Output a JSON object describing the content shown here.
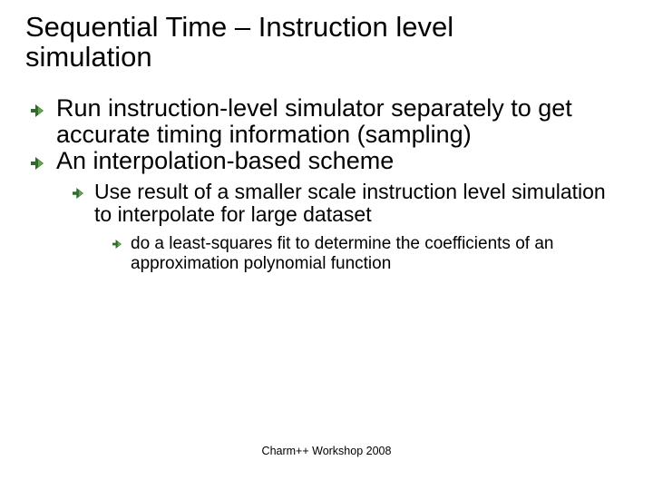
{
  "title": {
    "line1": "Sequential Time – Instruction level",
    "line2": "simulation"
  },
  "bullets": {
    "l1a": "Run instruction-level simulator separately to get accurate timing information (sampling)",
    "l1b": "An interpolation-based scheme",
    "l2a": "Use result of a smaller scale instruction level simulation to interpolate for large dataset",
    "l3a": "do a least-squares fit to determine the coefficients of an approximation polynomial function"
  },
  "footer": "Charm++ Workshop 2008",
  "icons": {
    "bullet_large": "arrow-bullet-icon",
    "bullet_medium": "arrow-bullet-icon",
    "bullet_small": "arrow-bullet-icon"
  },
  "colors": {
    "arrow_body": "#2f6b2f",
    "arrow_tip": "#6aa84f",
    "text": "#000000",
    "background": "#ffffff"
  }
}
